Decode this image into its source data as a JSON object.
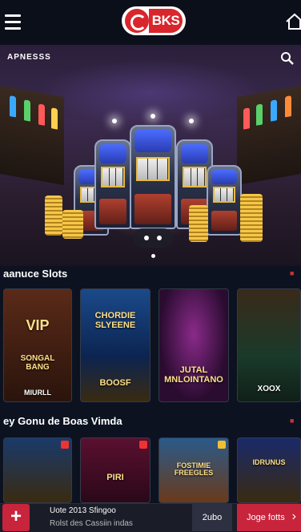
{
  "header": {
    "logo_text": "BKS",
    "menu_icon": "hamburger-menu-icon",
    "home_icon": "home-icon"
  },
  "hero": {
    "title": "APNESSS",
    "search_icon": "search-icon",
    "carousel_control_icon": "carousel-pause-icon"
  },
  "sections": [
    {
      "title": "aanuce Slots",
      "games": [
        {
          "art_text": "VIP",
          "sub_text": "SONGAL BANG",
          "label": "MIURLL"
        },
        {
          "art_text": "CHORDIE SLYEENE",
          "sub_text": "BOOSF",
          "label": ""
        },
        {
          "art_text": "JUTAL MNLOINTANO",
          "sub_text": "",
          "label": ""
        },
        {
          "art_text": "",
          "sub_text": "",
          "label": "XOOX"
        }
      ]
    },
    {
      "title": "ey Gonu de Boas Vimda",
      "games": [
        {
          "art_text": "",
          "label": ""
        },
        {
          "art_text": "PIRI",
          "label": ""
        },
        {
          "art_text": "FOSTIMIE FREEGLES",
          "label": ""
        },
        {
          "art_text": "IDRUNUS",
          "label": ""
        }
      ]
    }
  ],
  "bottom_bar": {
    "plus_label": "+",
    "promo_line1": "Uote 2013 Sfingoo",
    "promo_line2": "Rolst des Cassiin indas",
    "secondary_button": "2ubo",
    "cta_button": "Joge fotts"
  },
  "colors": {
    "background": "#0d1220",
    "accent": "#c8243c",
    "logo_red": "#d8262c"
  }
}
